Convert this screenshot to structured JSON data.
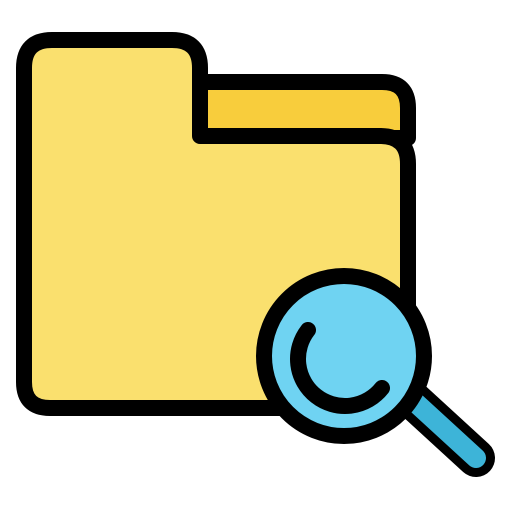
{
  "icon": {
    "name": "folder-search-icon",
    "colors": {
      "outline": "#000000",
      "folder_front": "#FAE06E",
      "folder_back": "#F8CD3C",
      "lens_glass": "#6FD3F2",
      "handle": "#3DB4D8"
    }
  }
}
